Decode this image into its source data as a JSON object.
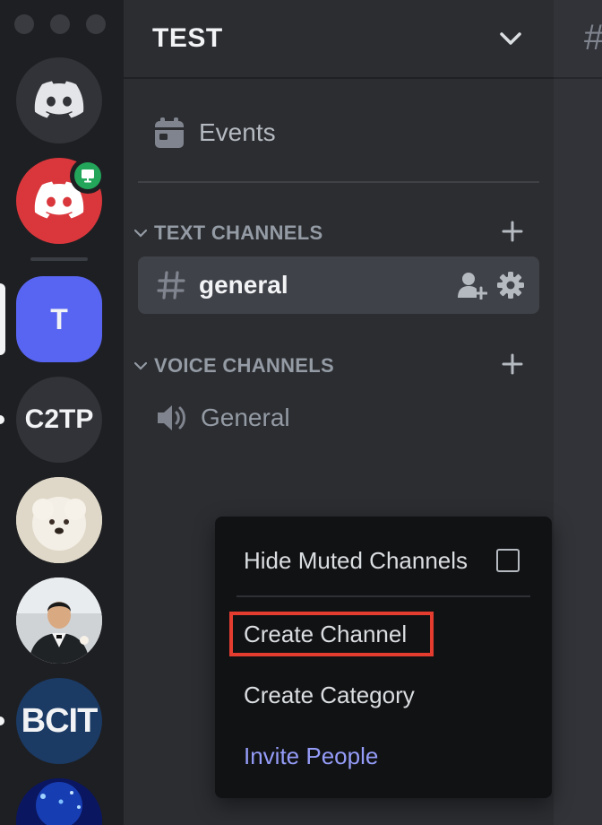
{
  "window": {
    "traffic_lights": [
      "close",
      "minimize",
      "maximize"
    ]
  },
  "rail": {
    "servers": [
      {
        "id": "home",
        "icon": "discord-logo-icon",
        "color": "#313338"
      },
      {
        "id": "dm-red",
        "icon": "discord-logo-icon",
        "color": "#da373c",
        "badge_icon": "monitor-icon",
        "badge_color": "#23a55a"
      },
      {
        "id": "test",
        "label": "T",
        "color": "#5865f2",
        "selected": true
      },
      {
        "id": "c2tp",
        "label": "C2TP",
        "color": "#313338",
        "unread": true
      },
      {
        "id": "dog",
        "icon": "server-image-dog",
        "color": "#e7e2d8"
      },
      {
        "id": "person",
        "icon": "server-image-person",
        "color": "#d9d9d9"
      },
      {
        "id": "bcit",
        "label": "BCIT",
        "color": "#1b3a64",
        "unread": true
      },
      {
        "id": "blue",
        "icon": "server-image-blue",
        "color": "#0b1b6e"
      }
    ]
  },
  "sidebar": {
    "server_name": "TEST",
    "events_label": "Events",
    "categories": [
      {
        "label": "TEXT CHANNELS",
        "channels": [
          {
            "name": "general",
            "type": "text",
            "active": true
          }
        ]
      },
      {
        "label": "VOICE CHANNELS",
        "channels": [
          {
            "name": "General",
            "type": "voice",
            "active": false
          }
        ]
      }
    ]
  },
  "context_menu": {
    "hide_muted": "Hide Muted Channels",
    "hide_muted_checked": false,
    "create_channel": "Create Channel",
    "create_category": "Create Category",
    "invite_people": "Invite People",
    "highlight_color": "#e43d2f"
  },
  "main": {
    "header_icon": "hash-icon"
  }
}
